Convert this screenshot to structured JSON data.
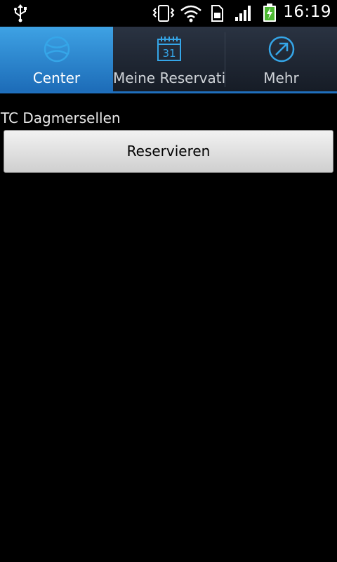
{
  "status_bar": {
    "time": "16:19",
    "icons": [
      "usb-icon",
      "vibrate-icon",
      "wifi-icon",
      "sim-icon",
      "signal-icon",
      "battery-charging-icon"
    ]
  },
  "tabs": [
    {
      "label": "Center",
      "icon": "tennis-ball-icon",
      "active": true
    },
    {
      "label": "Meine Reservationen",
      "icon": "calendar-icon",
      "calendar_day": "31",
      "active": false
    },
    {
      "label": "Mehr",
      "icon": "arrow-out-icon",
      "active": false
    }
  ],
  "main": {
    "center_name": "TC Dagmersellen",
    "reserve_button": "Reservieren"
  },
  "colors": {
    "accent": "#2b8ad6",
    "icon_blue": "#35a6e8",
    "background": "#000000"
  }
}
